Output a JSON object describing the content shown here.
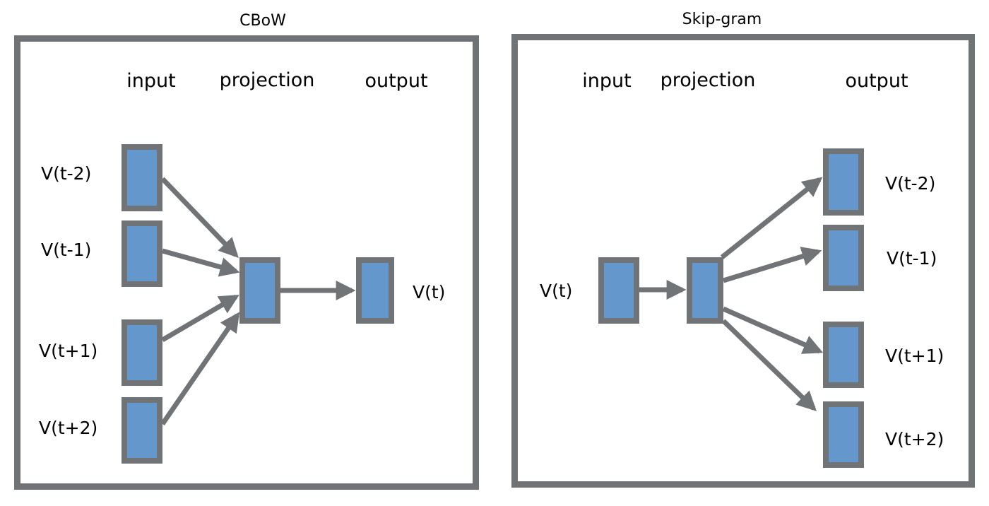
{
  "colors": {
    "frame": "#707376",
    "box_fill": "#6497cb",
    "box_stroke": "#717477",
    "arrow": "#717477",
    "text": "#1a1a1a"
  },
  "panels": [
    {
      "id": "cbow",
      "title": "CBoW",
      "columns": [
        "input",
        "projection",
        "output"
      ],
      "input_labels": [
        "V(t-2)",
        "V(t-1)",
        "V(t+1)",
        "V(t+2)"
      ],
      "output_labels": [
        "V(t)"
      ]
    },
    {
      "id": "skipgram",
      "title": "Skip-gram",
      "columns": [
        "input",
        "projection",
        "output"
      ],
      "input_labels": [
        "V(t)"
      ],
      "output_labels": [
        "V(t-2)",
        "V(t-1)",
        "V(t+1)",
        "V(t+2)"
      ]
    }
  ]
}
